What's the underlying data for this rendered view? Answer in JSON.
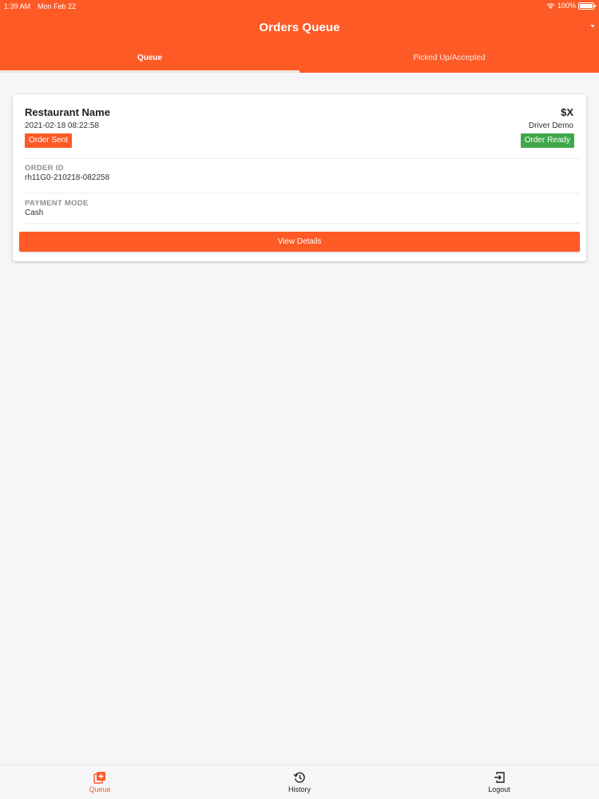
{
  "status_bar": {
    "time": "1:39 AM",
    "date": "Mon Feb 22",
    "battery": "100%"
  },
  "header": {
    "title": "Orders Queue"
  },
  "tabs": [
    {
      "label": "Queue",
      "active": true
    },
    {
      "label": "Picked Up/Accepted",
      "active": false
    }
  ],
  "order": {
    "restaurant_name": "Restaurant Name",
    "date": "2021-02-18 08:22:58",
    "price": "$X",
    "driver": "Driver Demo",
    "status_left": "Order Sent",
    "status_right": "Order Ready",
    "order_id_label": "ORDER ID",
    "order_id": "rh11G0-210218-082258",
    "payment_label": "PAYMENT MODE",
    "payment": "Cash",
    "button_label": "View Details"
  },
  "bottom_nav": [
    {
      "label": "Queue",
      "icon": "queue-add-icon",
      "active": true
    },
    {
      "label": "History",
      "icon": "history-icon",
      "active": false
    },
    {
      "label": "Logout",
      "icon": "logout-icon",
      "active": false
    }
  ],
  "colors": {
    "brand": "#fe5a25",
    "ready_green": "#3ea74a",
    "background": "#f6f6f8"
  }
}
